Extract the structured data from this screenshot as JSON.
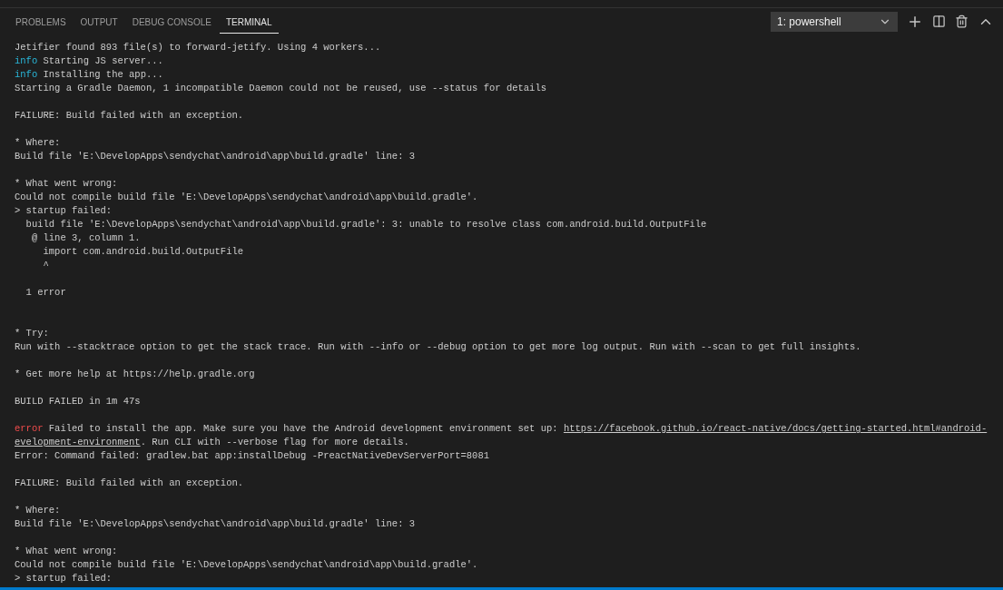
{
  "tabs": [
    {
      "label": "PROBLEMS",
      "selected": false
    },
    {
      "label": "OUTPUT",
      "selected": false
    },
    {
      "label": "DEBUG CONSOLE",
      "selected": false
    },
    {
      "label": "TERMINAL",
      "selected": true
    }
  ],
  "terminal_select": {
    "value": "1: powershell"
  },
  "lines": [
    {
      "kind": "text",
      "segments": [
        {
          "kind": "plain",
          "text": "Jetifier found 893 file(s) to forward-jetify. Using 4 workers..."
        }
      ]
    },
    {
      "kind": "text",
      "segments": [
        {
          "kind": "info",
          "text": "info"
        },
        {
          "kind": "plain",
          "text": " Starting JS server..."
        }
      ]
    },
    {
      "kind": "text",
      "segments": [
        {
          "kind": "info",
          "text": "info"
        },
        {
          "kind": "plain",
          "text": " Installing the app..."
        }
      ]
    },
    {
      "kind": "text",
      "segments": [
        {
          "kind": "plain",
          "text": "Starting a Gradle Daemon, 1 incompatible Daemon could not be reused, use --status for details"
        }
      ]
    },
    {
      "kind": "blank"
    },
    {
      "kind": "text",
      "segments": [
        {
          "kind": "plain",
          "text": "FAILURE: Build failed with an exception."
        }
      ]
    },
    {
      "kind": "blank"
    },
    {
      "kind": "text",
      "segments": [
        {
          "kind": "plain",
          "text": "* Where:"
        }
      ]
    },
    {
      "kind": "text",
      "segments": [
        {
          "kind": "plain",
          "text": "Build file 'E:\\DevelopApps\\sendychat\\android\\app\\build.gradle' line: 3"
        }
      ]
    },
    {
      "kind": "blank"
    },
    {
      "kind": "text",
      "segments": [
        {
          "kind": "plain",
          "text": "* What went wrong:"
        }
      ]
    },
    {
      "kind": "text",
      "segments": [
        {
          "kind": "plain",
          "text": "Could not compile build file 'E:\\DevelopApps\\sendychat\\android\\app\\build.gradle'."
        }
      ]
    },
    {
      "kind": "text",
      "segments": [
        {
          "kind": "plain",
          "text": "> startup failed:"
        }
      ]
    },
    {
      "kind": "text",
      "segments": [
        {
          "kind": "plain",
          "text": "  build file 'E:\\DevelopApps\\sendychat\\android\\app\\build.gradle': 3: unable to resolve class com.android.build.OutputFile"
        }
      ]
    },
    {
      "kind": "text",
      "segments": [
        {
          "kind": "plain",
          "text": "   @ line 3, column 1."
        }
      ]
    },
    {
      "kind": "text",
      "segments": [
        {
          "kind": "plain",
          "text": "     import com.android.build.OutputFile"
        }
      ]
    },
    {
      "kind": "text",
      "segments": [
        {
          "kind": "plain",
          "text": "     ^"
        }
      ]
    },
    {
      "kind": "blank"
    },
    {
      "kind": "text",
      "segments": [
        {
          "kind": "plain",
          "text": "  1 error"
        }
      ]
    },
    {
      "kind": "blank"
    },
    {
      "kind": "blank"
    },
    {
      "kind": "text",
      "segments": [
        {
          "kind": "plain",
          "text": "* Try:"
        }
      ]
    },
    {
      "kind": "text",
      "segments": [
        {
          "kind": "plain",
          "text": "Run with --stacktrace option to get the stack trace. Run with --info or --debug option to get more log output. Run with --scan to get full insights."
        }
      ]
    },
    {
      "kind": "blank"
    },
    {
      "kind": "text",
      "segments": [
        {
          "kind": "plain",
          "text": "* Get more help at https://help.gradle.org"
        }
      ]
    },
    {
      "kind": "blank"
    },
    {
      "kind": "text",
      "segments": [
        {
          "kind": "plain",
          "text": "BUILD FAILED in 1m 47s"
        }
      ]
    },
    {
      "kind": "blank"
    },
    {
      "kind": "text",
      "segments": [
        {
          "kind": "error",
          "text": "error"
        },
        {
          "kind": "plain",
          "text": " Failed to install the app. Make sure you have the Android development environment set up: "
        },
        {
          "kind": "link",
          "text": "https://facebook.github.io/react-native/docs/getting-started.html#android-"
        }
      ]
    },
    {
      "kind": "text",
      "segments": [
        {
          "kind": "link",
          "text": "evelopment-environment"
        },
        {
          "kind": "plain",
          "text": ". Run CLI with --verbose flag for more details."
        }
      ]
    },
    {
      "kind": "text",
      "segments": [
        {
          "kind": "plain",
          "text": "Error: Command failed: gradlew.bat app:installDebug -PreactNativeDevServerPort=8081"
        }
      ]
    },
    {
      "kind": "blank"
    },
    {
      "kind": "text",
      "segments": [
        {
          "kind": "plain",
          "text": "FAILURE: Build failed with an exception."
        }
      ]
    },
    {
      "kind": "blank"
    },
    {
      "kind": "text",
      "segments": [
        {
          "kind": "plain",
          "text": "* Where:"
        }
      ]
    },
    {
      "kind": "text",
      "segments": [
        {
          "kind": "plain",
          "text": "Build file 'E:\\DevelopApps\\sendychat\\android\\app\\build.gradle' line: 3"
        }
      ]
    },
    {
      "kind": "blank"
    },
    {
      "kind": "text",
      "segments": [
        {
          "kind": "plain",
          "text": "* What went wrong:"
        }
      ]
    },
    {
      "kind": "text",
      "segments": [
        {
          "kind": "plain",
          "text": "Could not compile build file 'E:\\DevelopApps\\sendychat\\android\\app\\build.gradle'."
        }
      ]
    },
    {
      "kind": "text",
      "segments": [
        {
          "kind": "plain",
          "text": "> startup failed:"
        }
      ]
    }
  ]
}
